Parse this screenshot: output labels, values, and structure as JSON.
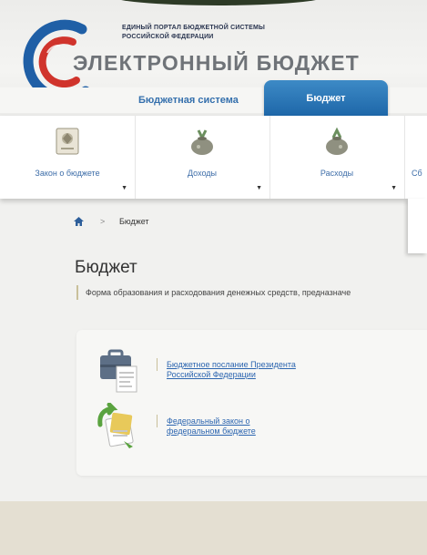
{
  "header": {
    "portal_line1": "ЕДИНЫЙ ПОРТАЛ БЮДЖЕТНОЙ СИСТЕМЫ",
    "portal_line2": "РОССИЙСКОЙ ФЕДЕРАЦИИ",
    "brand": "ЭЛЕКТРОННЫЙ БЮДЖЕТ",
    "nav_link": "Бюджетная система",
    "active_tab": "Бюджет"
  },
  "menu": {
    "items": [
      {
        "label": "Закон о бюджете",
        "icon": "emblem-document-icon"
      },
      {
        "label": "Доходы",
        "icon": "money-bag-in-icon"
      },
      {
        "label": "Расходы",
        "icon": "money-bag-out-icon"
      }
    ],
    "cut_label": "Сб"
  },
  "breadcrumb": {
    "separator": ">",
    "current": "Бюджет"
  },
  "main": {
    "title": "Бюджет",
    "description": "Форма образования и расходования денежных средств, предназначе",
    "documents": [
      {
        "line1": "Бюджетное послание Президента",
        "line2": "Российской Федерации",
        "icon": "briefcase-document-icon"
      },
      {
        "line1": "Федеральный закон о",
        "line2": "федеральном бюджете",
        "icon": "law-document-icon"
      }
    ]
  },
  "colors": {
    "accent_blue": "#1d66a8",
    "link_blue": "#2d66b0",
    "logo_red": "#d0342c",
    "logo_blue": "#1f5fa6"
  }
}
